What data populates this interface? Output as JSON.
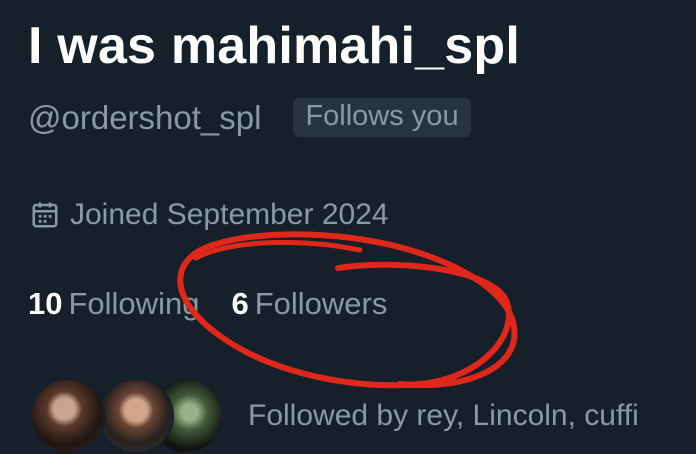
{
  "profile": {
    "display_name": "I was mahimahi_spl",
    "handle": "@ordershot_spl",
    "follows_you_badge": "Follows you",
    "joined": "Joined September 2024",
    "following_count": "10",
    "following_label": "Following",
    "followers_count": "6",
    "followers_label": "Followers",
    "followed_by": "Followed by rey, Lincoln, cuffi"
  },
  "icons": {
    "joined": "calendar-icon"
  },
  "annotation": {
    "color": "#e0281a",
    "shape": "hand-drawn-ellipse-around-followers"
  },
  "colors": {
    "background": "#15202b",
    "primary_text": "#ffffff",
    "secondary_text": "#8b98a5",
    "badge_bg": "#273340"
  }
}
